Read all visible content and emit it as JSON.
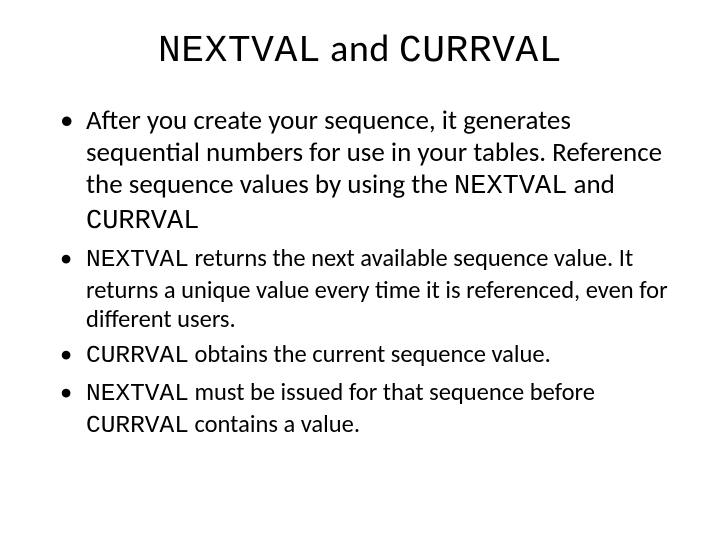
{
  "title": {
    "mono1": "NEXTVAL",
    "mid": " and ",
    "mono2": "CURRVAL"
  },
  "bullets": {
    "b1": {
      "t1": "After you create your sequence, it generates sequential numbers for use in your tables. Reference the sequence values by using the ",
      "m1": "NEXTVAL",
      "t2": " and ",
      "m2": "CURRVAL"
    },
    "b2": {
      "m1": "NEXTVAL",
      "t1": " returns the next available sequence value. It returns a unique value every time it is referenced, even for different users."
    },
    "b3": {
      "m1": "CURRVAL",
      "t1": " obtains the current sequence value."
    },
    "b4": {
      "m1": "NEXTVAL",
      "t1": " must be issued for that sequence before ",
      "m2": "CURRVAL",
      "t2": " contains a value."
    }
  }
}
